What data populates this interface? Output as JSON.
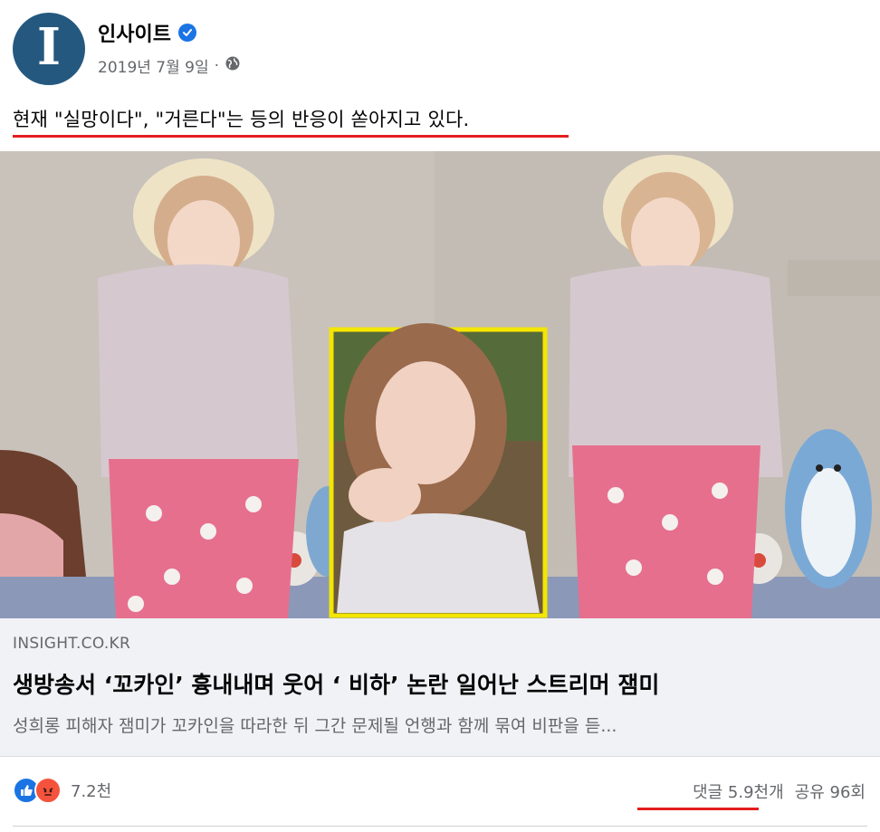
{
  "header": {
    "page_name": "인사이트",
    "date": "2019년 7월 9일",
    "separator": "·",
    "avatar_letter": "I",
    "avatar_color": "#24587f",
    "verified_icon": "verified-badge-icon",
    "privacy_icon": "globe-icon"
  },
  "post": {
    "text": "현재 \"실망이다\", \"거른다\"는 등의 반응이 쏟아지고 있다."
  },
  "link_preview": {
    "domain": "INSIGHT.CO.KR",
    "title": "생방송서 ‘꼬카인’ 흉내내며 웃어 ‘        비하’ 논란 일어난 스트리머 잼미",
    "description": "성희롱 피해자 잼미가 꼬카인을 따라한 뒤 그간 문제될 언행과 함께 묶여 비판을 듣..."
  },
  "reactions": {
    "count": "7.2천",
    "icons": [
      "like-icon",
      "angry-icon"
    ]
  },
  "stats": {
    "comments": "댓글 5.9천개",
    "shares": "공유 96회"
  },
  "colors": {
    "accent": "#1b74e4",
    "annotation_red": "#e41e1e",
    "highlight_yellow": "#f3e600"
  }
}
